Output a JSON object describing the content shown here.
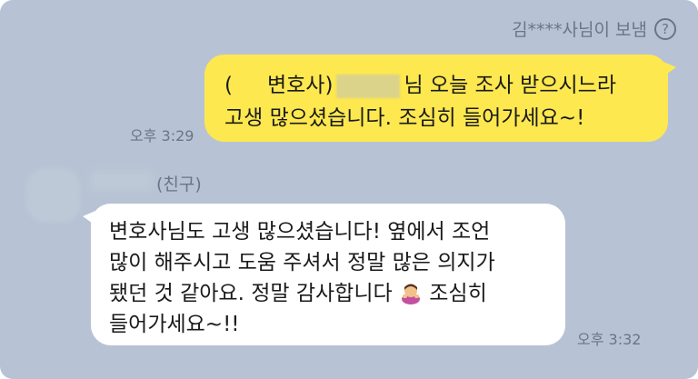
{
  "chat": {
    "sender_note": "김****사님이 보냄",
    "help_icon": "?",
    "outgoing": {
      "line1_prefix": "(",
      "line1_mid": "변호사)",
      "line1_suffix": "님 오늘 조사 받으시느라",
      "line2": "고생 많으셨습니다. 조심히 들어가세요~!",
      "time": "오후 3:29"
    },
    "friend_label": "(친구)",
    "incoming": {
      "line1": "변호사님도 고생 많으셨습니다! 옆에서 조언",
      "line2": "많이 해주시고 도움 주셔서 정말 많은 의지가",
      "line3_before": "됐던 것 같아요. 정말 감사합니다",
      "line3_after": "조심히",
      "line4": "들어가세요~!!",
      "time": "오후 3:32",
      "emoji_icon": "bowing-person-icon"
    }
  }
}
